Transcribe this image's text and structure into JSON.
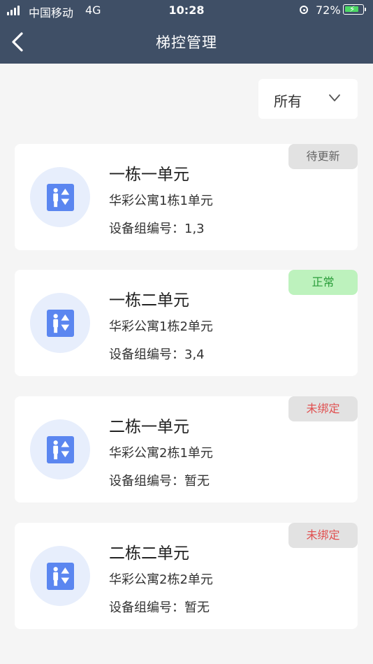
{
  "status_bar": {
    "carrier": "中国移动",
    "network": "4G",
    "time": "10:28",
    "battery": "72%",
    "battery_level": 0.72
  },
  "header": {
    "title": "梯控管理"
  },
  "filter": {
    "selected": "所有"
  },
  "colors": {
    "header_bg": "#3f4f66",
    "icon_blue": "#5b86f0",
    "badge_normal_bg": "#bdf2bd",
    "badge_unbound_text": "#e05050"
  },
  "cards": [
    {
      "title": "一栋一单元",
      "address": "华彩公寓1栋1单元",
      "group_label": "设备组编号：",
      "group_value": "1,3",
      "status": "待更新",
      "status_type": "pending"
    },
    {
      "title": "一栋二单元",
      "address": "华彩公寓1栋2单元",
      "group_label": "设备组编号：",
      "group_value": "3,4",
      "status": "正常",
      "status_type": "normal"
    },
    {
      "title": "二栋一单元",
      "address": "华彩公寓2栋1单元",
      "group_label": "设备组编号：",
      "group_value": "暂无",
      "status": "未绑定",
      "status_type": "unbound"
    },
    {
      "title": "二栋二单元",
      "address": "华彩公寓2栋2单元",
      "group_label": "设备组编号：",
      "group_value": "暂无",
      "status": "未绑定",
      "status_type": "unbound"
    }
  ]
}
